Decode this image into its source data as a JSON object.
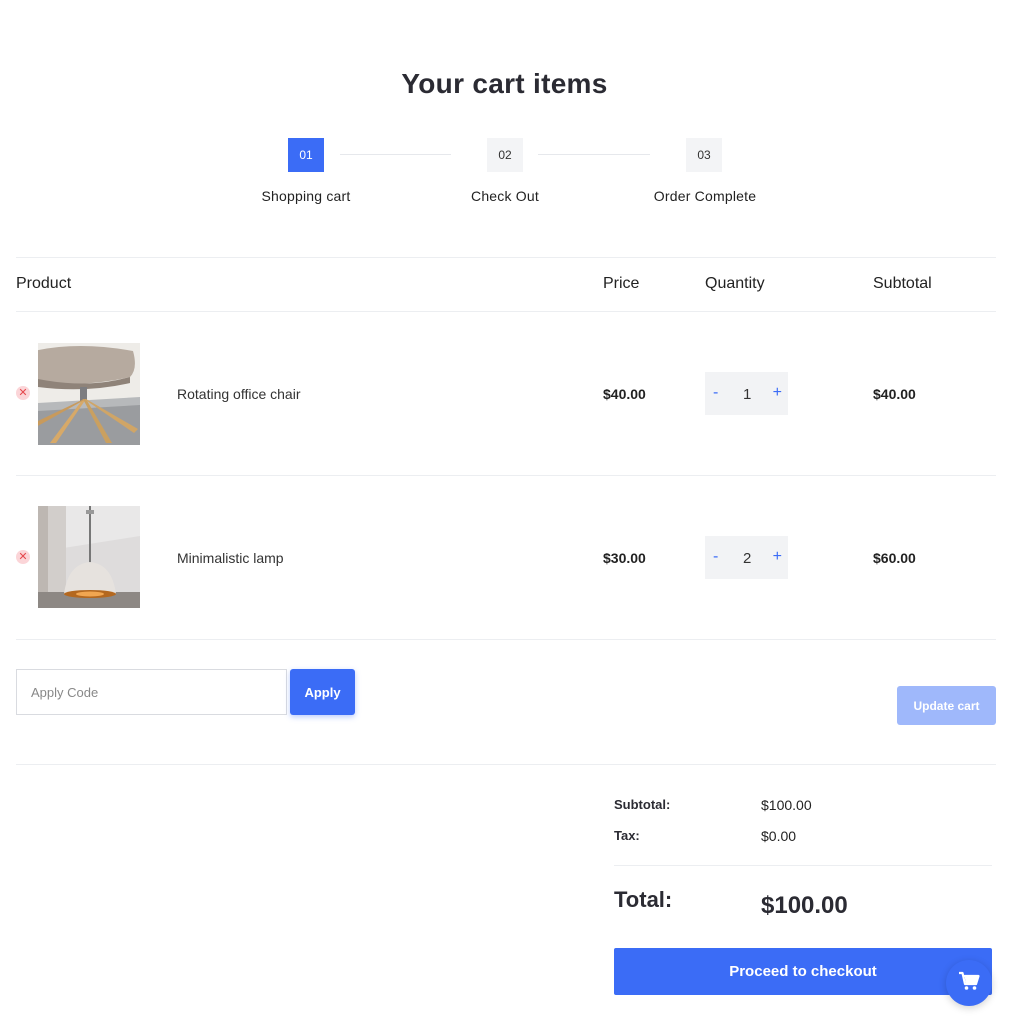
{
  "page": {
    "title": "Your cart items"
  },
  "steps": [
    {
      "number": "01",
      "label": "Shopping cart"
    },
    {
      "number": "02",
      "label": "Check Out"
    },
    {
      "number": "03",
      "label": "Order Complete"
    }
  ],
  "table": {
    "headers": {
      "product": "Product",
      "price": "Price",
      "quantity": "Quantity",
      "subtotal": "Subtotal"
    },
    "rows": [
      {
        "name": "Rotating office chair",
        "price": "$40.00",
        "qty_minus": "-",
        "quantity": "1",
        "qty_plus": "+",
        "subtotal": "$40.00",
        "image": "office-chair-photo"
      },
      {
        "name": "Minimalistic lamp",
        "price": "$30.00",
        "qty_minus": "-",
        "quantity": "2",
        "qty_plus": "+",
        "subtotal": "$60.00",
        "image": "pendant-lamp-photo"
      }
    ]
  },
  "coupon": {
    "placeholder": "Apply Code",
    "apply_label": "Apply"
  },
  "update_cart_label": "Update cart",
  "summary": {
    "subtotal_label": "Subtotal:",
    "subtotal_value": "$100.00",
    "tax_label": "Tax:",
    "tax_value": "$0.00",
    "total_label": "Total:",
    "total_value": "$100.00"
  },
  "checkout_label": "Proceed to checkout",
  "colors": {
    "accent": "#3b6cf6",
    "accent_light": "#9fb8fb",
    "remove": "#e5484d"
  },
  "icons": {
    "remove": "close-icon",
    "cart": "shopping-cart-icon"
  }
}
